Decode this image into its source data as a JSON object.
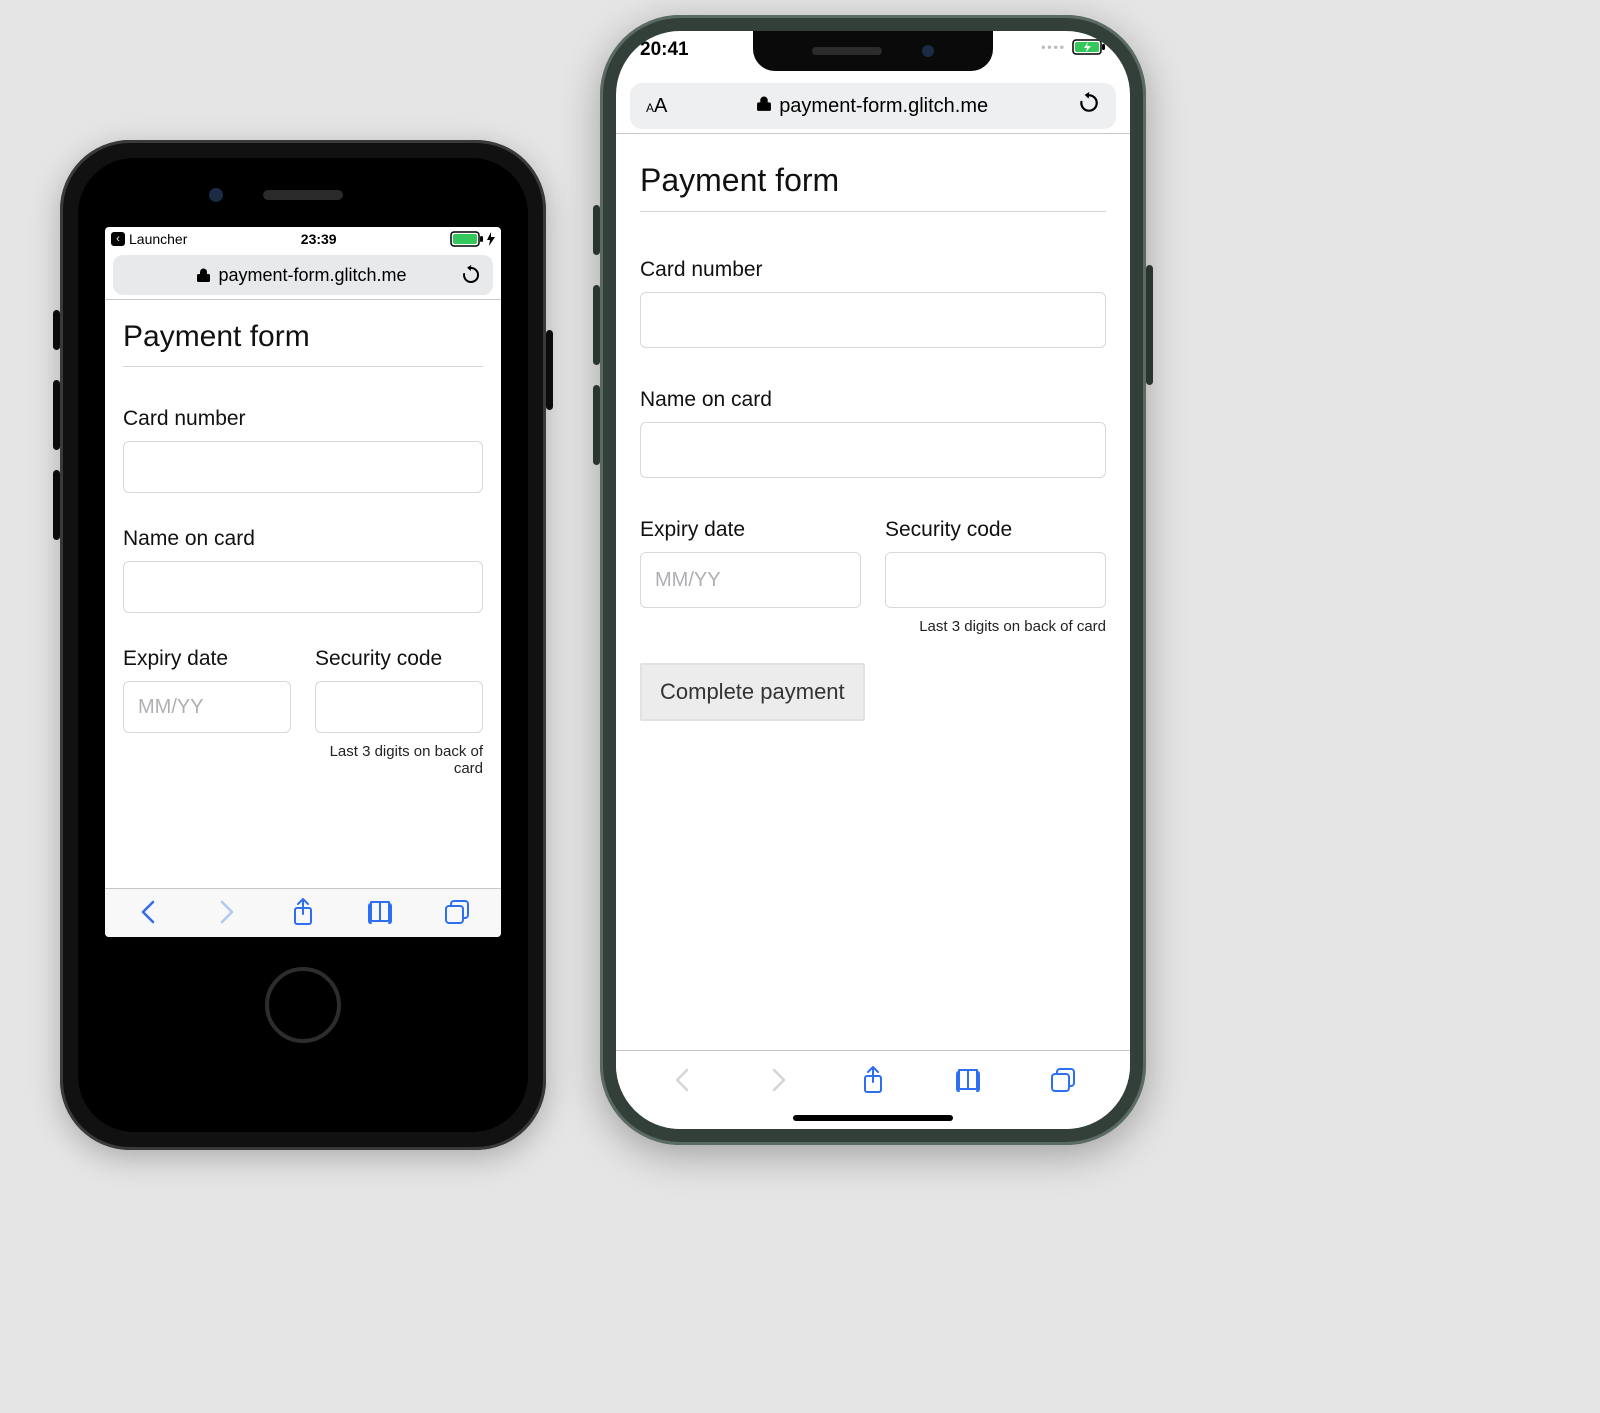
{
  "left": {
    "status": {
      "back_app": "Launcher",
      "time": "23:39"
    },
    "url": "payment-form.glitch.me",
    "page": {
      "title": "Payment form",
      "card_number_label": "Card number",
      "name_label": "Name on card",
      "expiry_label": "Expiry date",
      "expiry_placeholder": "MM/YY",
      "cvc_label": "Security code",
      "cvc_hint": "Last 3 digits on back of card"
    }
  },
  "right": {
    "status": {
      "time": "20:41"
    },
    "url_aa": "AA",
    "url": "payment-form.glitch.me",
    "page": {
      "title": "Payment form",
      "card_number_label": "Card number",
      "name_label": "Name on card",
      "expiry_label": "Expiry date",
      "expiry_placeholder": "MM/YY",
      "cvc_label": "Security code",
      "cvc_hint": "Last 3 digits on back of card",
      "submit_label": "Complete payment"
    }
  }
}
